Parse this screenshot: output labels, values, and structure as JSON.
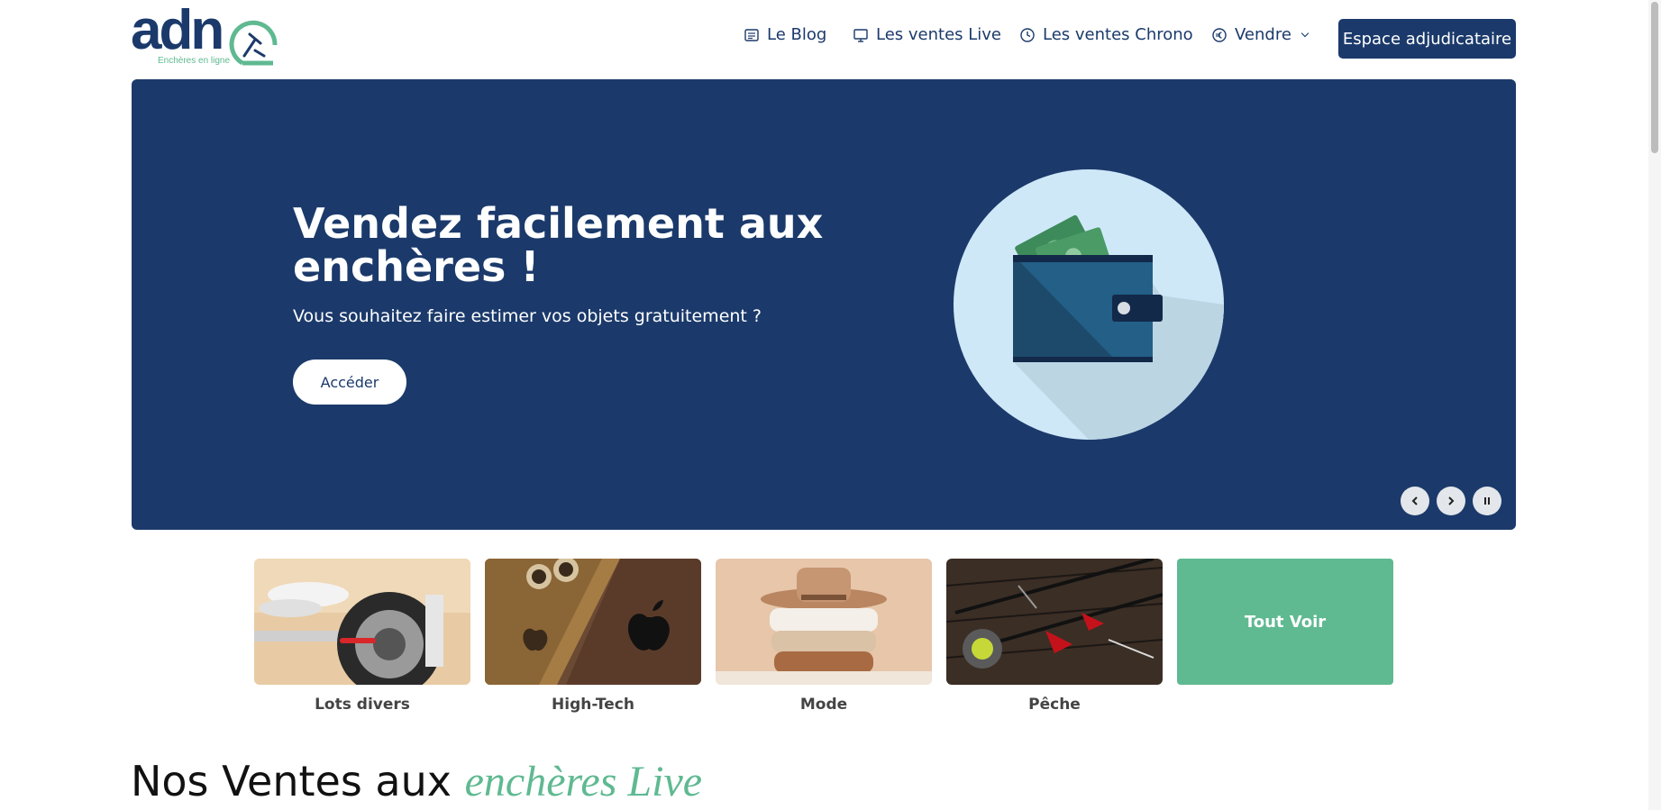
{
  "header": {
    "logo_text": "adn",
    "logo_subtitle": "Enchères en ligne",
    "nav": {
      "blog": "Le Blog",
      "live": "Les ventes Live",
      "chrono": "Les ventes Chrono",
      "vendre": "Vendre"
    },
    "espace_button": "Espace adjudicataire"
  },
  "hero": {
    "title": "Vendez facilement aux enchères !",
    "subtitle": "Vous souhaitez faire estimer vos objets gratuitement ?",
    "button": "Accéder",
    "illustration": "wallet-icon"
  },
  "categories": {
    "items": [
      {
        "label": "Lots divers",
        "icon": "scooter-image"
      },
      {
        "label": "High-Tech",
        "icon": "smartphone-image"
      },
      {
        "label": "Mode",
        "icon": "clothes-image"
      },
      {
        "label": "Pêche",
        "icon": "fishing-image"
      }
    ],
    "see_all": "Tout Voir"
  },
  "section": {
    "title_main": "Nos Ventes aux",
    "title_accent": "enchères Live"
  },
  "colors": {
    "brand": "#1b3a6b",
    "accent": "#5fb991"
  }
}
